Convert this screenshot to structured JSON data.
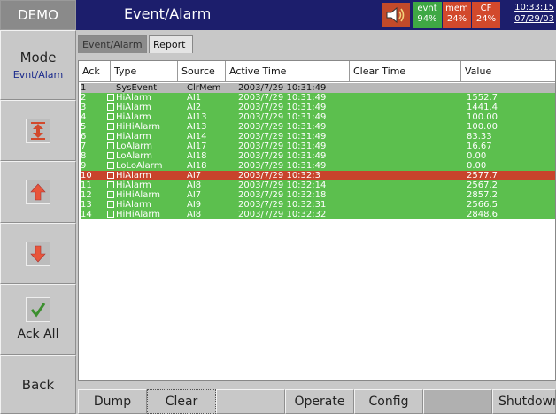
{
  "header": {
    "demo_label": "DEMO",
    "title": "Event/Alarm",
    "evnt_label": "evnt",
    "evnt_value": "94%",
    "mem_label": "mem",
    "mem_value": "24%",
    "cf_label": "CF",
    "cf_value": "24%",
    "time": "10:33:15",
    "date": "07/29/03",
    "colors": {
      "bar": "#1c1e6c",
      "evnt": "#3fa844",
      "mem": "#d2492c",
      "cf": "#d2492c"
    }
  },
  "sidebar": {
    "mode_label": "Mode",
    "mode_value": "Evnt/Alam",
    "ack_all_label": "Ack All",
    "back_label": "Back",
    "icons": [
      "top-bottom-arrows-icon",
      "arrow-up-icon",
      "arrow-down-icon",
      "checkmark-icon"
    ]
  },
  "tabs": [
    {
      "label": "Event/Alarm",
      "active": true
    },
    {
      "label": "Report",
      "active": false
    }
  ],
  "table": {
    "columns": [
      "Ack",
      "Type",
      "Source",
      "Active Time",
      "Clear Time",
      "Value"
    ],
    "rows": [
      {
        "num": "1",
        "type": "SysEvent",
        "source": "ClrMem",
        "active": "2003/7/29 10:31:49",
        "clear": "",
        "value": "",
        "color": "#b8b8b8",
        "checkbox": false
      },
      {
        "num": "2",
        "type": "HiAlarm",
        "source": "AI1",
        "active": "2003/7/29 10:31:49",
        "clear": "",
        "value": "1552.7",
        "color": "#5cbf4e",
        "checkbox": true
      },
      {
        "num": "3",
        "type": "HiAlarm",
        "source": "AI2",
        "active": "2003/7/29 10:31:49",
        "clear": "",
        "value": "1441.4",
        "color": "#5cbf4e",
        "checkbox": true
      },
      {
        "num": "4",
        "type": "HiAlarm",
        "source": "AI13",
        "active": "2003/7/29 10:31:49",
        "clear": "",
        "value": "100.00",
        "color": "#5cbf4e",
        "checkbox": true
      },
      {
        "num": "5",
        "type": "HiHiAlarm",
        "source": "AI13",
        "active": "2003/7/29 10:31:49",
        "clear": "",
        "value": "100.00",
        "color": "#5cbf4e",
        "checkbox": true
      },
      {
        "num": "6",
        "type": "HiAlarm",
        "source": "AI14",
        "active": "2003/7/29 10:31:49",
        "clear": "",
        "value": "83.33",
        "color": "#5cbf4e",
        "checkbox": true
      },
      {
        "num": "7",
        "type": "LoAlarm",
        "source": "AI17",
        "active": "2003/7/29 10:31:49",
        "clear": "",
        "value": "16.67",
        "color": "#5cbf4e",
        "checkbox": true
      },
      {
        "num": "8",
        "type": "LoAlarm",
        "source": "AI18",
        "active": "2003/7/29 10:31:49",
        "clear": "",
        "value": "0.00",
        "color": "#5cbf4e",
        "checkbox": true
      },
      {
        "num": "9",
        "type": "LoLoAlarm",
        "source": "AI18",
        "active": "2003/7/29 10:31:49",
        "clear": "",
        "value": "0.00",
        "color": "#5cbf4e",
        "checkbox": true
      },
      {
        "num": "10",
        "type": "HiAlarm",
        "source": "AI7",
        "active": "2003/7/29 10:32:3",
        "clear": "",
        "value": "2577.7",
        "color": "#c8432c",
        "checkbox": true
      },
      {
        "num": "11",
        "type": "HiAlarm",
        "source": "AI8",
        "active": "2003/7/29 10:32:14",
        "clear": "",
        "value": "2567.2",
        "color": "#5cbf4e",
        "checkbox": true
      },
      {
        "num": "12",
        "type": "HiHiAlarm",
        "source": "AI7",
        "active": "2003/7/29 10:32:18",
        "clear": "",
        "value": "2857.2",
        "color": "#5cbf4e",
        "checkbox": true
      },
      {
        "num": "13",
        "type": "HiAlarm",
        "source": "AI9",
        "active": "2003/7/29 10:32:31",
        "clear": "",
        "value": "2566.5",
        "color": "#5cbf4e",
        "checkbox": true
      },
      {
        "num": "14",
        "type": "HiHiAlarm",
        "source": "AI8",
        "active": "2003/7/29 10:32:32",
        "clear": "",
        "value": "2848.6",
        "color": "#5cbf4e",
        "checkbox": true
      }
    ]
  },
  "bottom": {
    "dump_label": "Dump",
    "clear_label": "Clear",
    "operate_label": "Operate",
    "config_label": "Config",
    "shutdown_label": "Shutdown"
  }
}
